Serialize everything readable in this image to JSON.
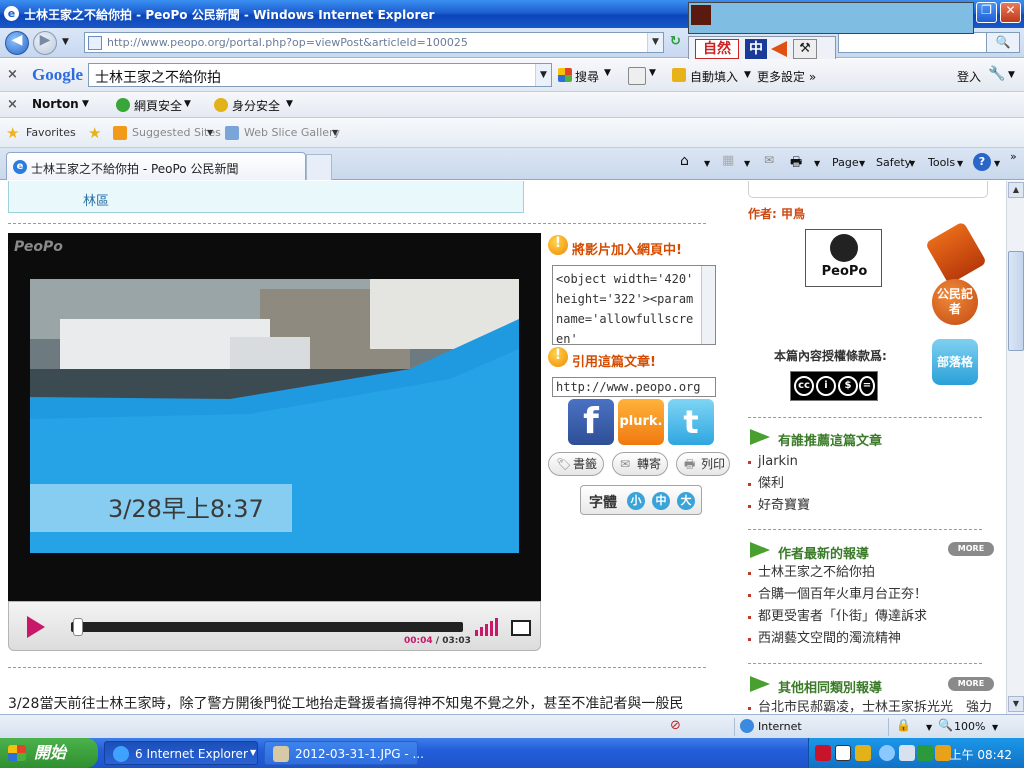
{
  "window": {
    "title": "士林王家之不給你拍 - PeoPo 公民新聞 - Windows Internet Explorer",
    "url": "http://www.peopo.org/portal.php?op=viewPost&articleId=100025"
  },
  "ime": {
    "label": "自然",
    "mode": "中"
  },
  "google_toolbar": {
    "logo": "Google",
    "query": "士林王家之不給你拍",
    "search_label": "搜尋",
    "autofill_label": "自動填入",
    "more_settings_label": "更多設定 »",
    "login_label": "登入"
  },
  "norton_toolbar": {
    "logo": "Norton",
    "web_safety_label": "網頁安全",
    "identity_safety_label": "身分安全"
  },
  "favorites_bar": {
    "favorites_label": "Favorites",
    "suggested_label": "Suggested Sites",
    "webslice_label": "Web Slice Gallery"
  },
  "tab": {
    "title": "士林王家之不給你拍 - PeoPo 公民新聞"
  },
  "command_bar": {
    "page_label": "Page",
    "safety_label": "Safety",
    "tools_label": "Tools"
  },
  "article": {
    "district": "林區",
    "video_brand": "PeoPo",
    "video_caption": "3/28早上8:37",
    "time_current": "00:04",
    "time_total": "03:03",
    "body_first_line": "3/28當天前往士林王家時，除了警方開後門從工地抬走聲援者搞得神不知鬼不覺之外，甚至不准記者與一般民"
  },
  "share": {
    "embed_title": "將影片加入網頁中!",
    "embed_code": "<object width='420' height='322'><param name='allowfullscreen'",
    "cite_title": "引用這篇文章!",
    "cite_url": "http://www.peopo.org",
    "bookmark_label": "書籤",
    "forward_label": "轉寄",
    "print_label": "列印",
    "fontsize_label": "字體",
    "font_small": "小",
    "font_medium": "中",
    "font_large": "大",
    "facebook_label": "f",
    "plurk_label": "plurk.",
    "twitter_label": "t"
  },
  "sidebar": {
    "author": "作者: 甲鳥",
    "avatar_text": "PeoPo",
    "license_label": "本篇內容授權條款爲:",
    "badge_reporter": "公民記者",
    "badge_blog": "部落格",
    "recommend_title": "有誰推薦這篇文章",
    "recommenders": [
      "jlarkin",
      "傑利",
      "好奇寶寶"
    ],
    "latest_title": "作者最新的報導",
    "latest_items": [
      "士林王家之不給你拍",
      "合購一個百年火車月台正夯！",
      "都更受害者「仆街」傳達訴求",
      "西湖藝文空間的濁流精神"
    ],
    "same_title": "其他相同類別報導",
    "same_items": [
      "台北市民郝霸凌，士林王家拆光光　強力"
    ],
    "more_label": "MORE"
  },
  "status_bar": {
    "zone": "Internet",
    "zoom": "100%"
  },
  "taskbar": {
    "start_label": "開始",
    "ie_task": "6 Internet Explorer",
    "photo_task": "2012-03-31-1.JPG - ...",
    "clock": "上午 08:42"
  }
}
